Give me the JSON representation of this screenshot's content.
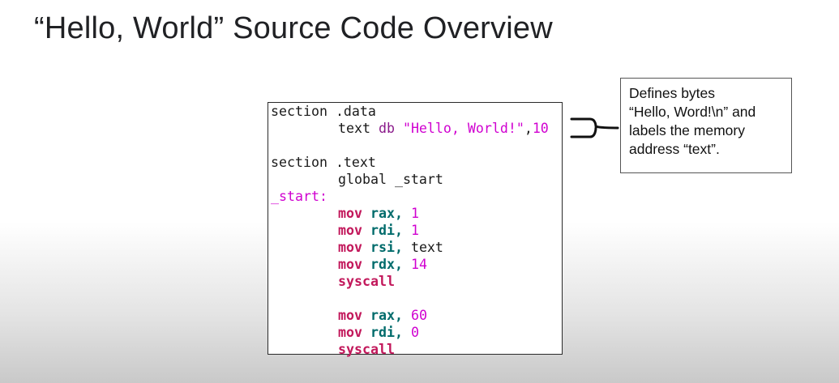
{
  "slide": {
    "title": "“Hello, World” Source Code Overview"
  },
  "code": {
    "section_kw": "section",
    "data_dir": ".data",
    "text_dir": ".text",
    "text_label": "text",
    "db_kw": "db",
    "string_literal": "\"Hello, World!\"",
    "comma": ",",
    "newline_value": "10",
    "global_kw": "global",
    "global_symbol": "_start",
    "start_label": "_start:",
    "mov_instr": "mov",
    "syscall_instr": "syscall",
    "reg_rax": "rax,",
    "reg_rdi": "rdi,",
    "reg_rsi": "rsi,",
    "reg_rdx": "rdx,",
    "write_syscall_num": "1",
    "stdout_fd": "1",
    "text_operand": "text",
    "length_value": "14",
    "exit_syscall_num": "60",
    "exit_code": "0"
  },
  "annotation": {
    "line1": "Defines bytes",
    "line2": "“Hello, Word!\\n” and",
    "line3": "labels the memory",
    "line4": "address “text”."
  }
}
